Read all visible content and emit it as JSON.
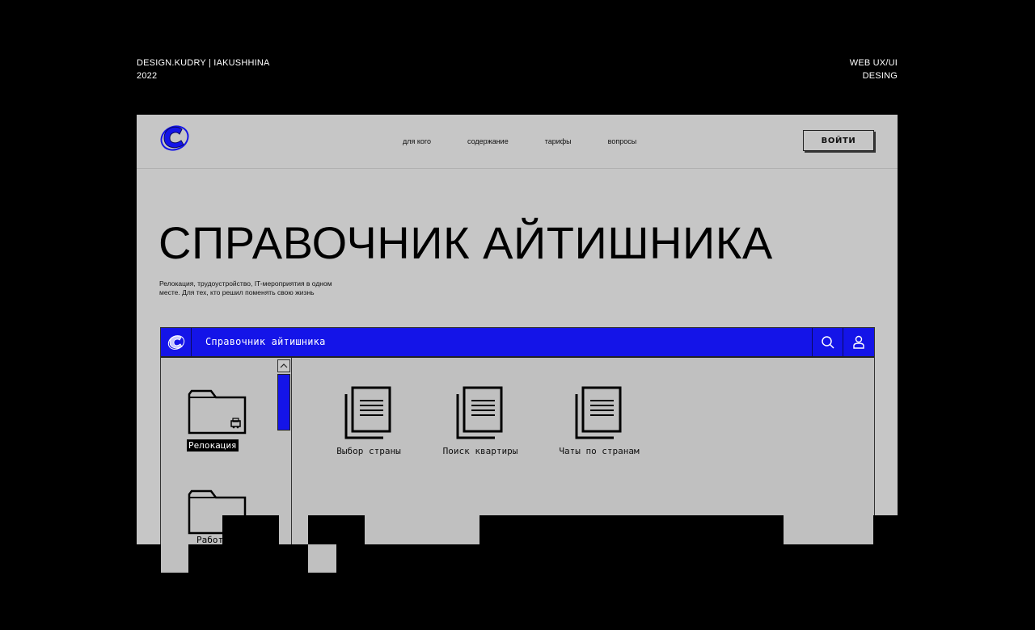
{
  "meta": {
    "left_line1": "DESIGN.KUDRY | IAKUSHHINA",
    "left_line2": "2022",
    "right_line1": "WEB UX/UI",
    "right_line2": "DESING"
  },
  "header": {
    "nav": [
      "для кого",
      "содержание",
      "тарифы",
      "вопросы"
    ],
    "login_label": "ВОЙТИ"
  },
  "hero": {
    "title": "СПРАВОЧНИК АЙТИШНИКА",
    "subtitle_line1": "Релокация, трудоустройство, IT-мероприятия в одном",
    "subtitle_line2": "месте. Для тех, кто решил поменять свою жизнь"
  },
  "window": {
    "title": "Справочник айтишника",
    "folders": [
      {
        "label": "Релокация",
        "selected": true
      },
      {
        "label": "Работа",
        "selected": false
      }
    ],
    "documents": [
      {
        "label": "Выбор страны"
      },
      {
        "label": "Поиск квартиры"
      },
      {
        "label": "Чаты по странам"
      }
    ]
  },
  "colors": {
    "accent": "#1414e8",
    "panel": "#c6c6c6",
    "background": "#000000"
  },
  "icons": {
    "logo": "logo-c-icon",
    "search": "search-icon",
    "user": "user-icon",
    "folder": "folder-icon",
    "document": "document-icon",
    "scroll_up": "chevron-up-icon"
  }
}
